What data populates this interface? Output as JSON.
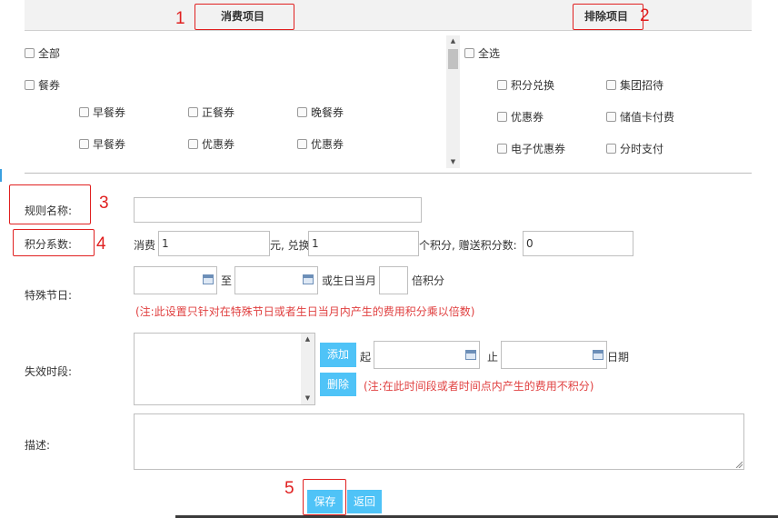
{
  "header": {
    "consume_title": "消费项目",
    "exclude_title": "排除项目"
  },
  "annotations": [
    "1",
    "2",
    "3",
    "4",
    "5"
  ],
  "consume": {
    "all_label": "全部",
    "voucher_label": "餐券",
    "sub_items": [
      "早餐券",
      "正餐券",
      "晚餐券",
      "早餐券",
      "优惠券",
      "优惠券"
    ]
  },
  "exclude": {
    "all_label": "全选",
    "items": [
      "积分兑换",
      "集团招待",
      "优惠券",
      "储值卡付费",
      "电子优惠券",
      "分时支付"
    ]
  },
  "form": {
    "rule_name_label": "规则名称:",
    "rule_name_value": "",
    "points_label": "积分系数:",
    "consume_prefix": "消费",
    "consume_value": "1",
    "yuan_exchange": "元, 兑换",
    "exchange_value": "1",
    "bonus_label": "个积分, 赠送积分数:",
    "bonus_value": "0",
    "holiday_label": "特殊节日:",
    "to_label": "至",
    "birthday_label": "或生日当月",
    "multiplier_value": "",
    "multiplier_suffix": "倍积分",
    "holiday_note": "(注:此设置只针对在特殊节日或者生日当月内产生的费用积分乘以倍数)",
    "invalid_label": "失效时段:",
    "add_button": "添加",
    "from_label": "起",
    "stop_label": "止",
    "date_label": "日期",
    "delete_button": "删除",
    "invalid_note": "(注:在此时间段或者时间点内产生的费用不积分)",
    "desc_label": "描述:"
  },
  "footer": {
    "save_button": "保存",
    "back_button": "返回"
  },
  "colors": {
    "accent_button": "#4fc3f7",
    "annotation_red": "#e02020",
    "note_red": "#e04040"
  }
}
